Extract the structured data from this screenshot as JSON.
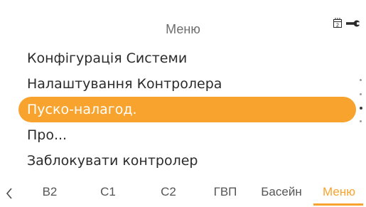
{
  "header": {
    "title": "Меню"
  },
  "status_icons": [
    {
      "name": "service-calendar-icon",
      "text": "2"
    },
    {
      "name": "wrench-icon"
    }
  ],
  "menu": {
    "items": [
      {
        "label": "Конфігурація Системи",
        "selected": false
      },
      {
        "label": "Налаштування Контролера",
        "selected": false
      },
      {
        "label": "Пуско-налагод.",
        "selected": true
      },
      {
        "label": "Про...",
        "selected": false
      },
      {
        "label": "Заблокувати контролер",
        "selected": false
      }
    ]
  },
  "tabs": {
    "items": [
      {
        "label": "B2",
        "active": false
      },
      {
        "label": "C1",
        "active": false
      },
      {
        "label": "C2",
        "active": false
      },
      {
        "label": "ГВП",
        "active": false
      },
      {
        "label": "Басейн",
        "active": false
      },
      {
        "label": "Меню",
        "active": true
      }
    ]
  },
  "colors": {
    "accent": "#f8a32d",
    "text": "#2b2b2b",
    "muted": "#6d6d6d",
    "background": "#ffffff"
  }
}
